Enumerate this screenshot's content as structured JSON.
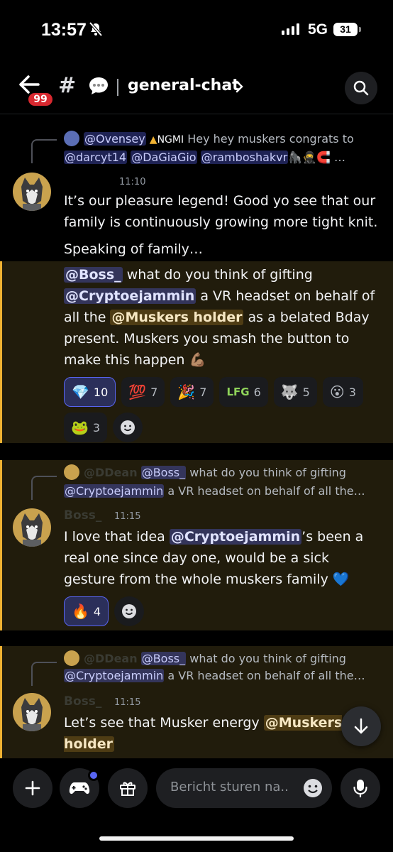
{
  "status": {
    "time": "13:57",
    "network": "5G",
    "battery": "31"
  },
  "header": {
    "unread_badge": "99",
    "hash": "#",
    "channel": "general-chat"
  },
  "messages": {
    "m1": {
      "reply_author": "@Ovensey",
      "reply_tag": "NGMI",
      "reply_text": " Hey hey muskers congrats to",
      "reply_mentions": [
        "@darcyt14",
        "@DaGiaGio",
        "@ramboshakvr"
      ],
      "reply_tail": "🦍🥷🧲 …",
      "time": "11:10",
      "text1": "It’s our pleasure legend! Good yo see that our family is continuously growing more tight knit.",
      "text2": "Speaking of family…",
      "hl_mention1": "@Boss_",
      "hl_t1": " what do you think of gifting",
      "hl_mention2": "@Cryptoejammin",
      "hl_t2": " a VR headset on behalf of all the ",
      "hl_mention3": "@Muskers holder",
      "hl_t3": " as a belated Bday present. Muskers you smash the button to make this happen 💪🏽",
      "reactions": [
        {
          "emoji": "💎",
          "count": "10"
        },
        {
          "emoji": "💯",
          "count": "7"
        },
        {
          "emoji": "🎉",
          "count": "7"
        },
        {
          "emoji": "LFG",
          "count": "6"
        },
        {
          "emoji": "🐺",
          "count": "5"
        },
        {
          "emoji": "😮",
          "count": "3"
        },
        {
          "emoji": "🐸",
          "count": "3"
        }
      ]
    },
    "m2": {
      "reply_author": "@DDean",
      "reply_mention": "@Boss_",
      "reply_text": " what do you think of gifting",
      "reply_mention2": "@Cryptoejammin",
      "reply_text2": " a VR headset on behalf of all the…",
      "author": "Boss_",
      "time": "11:15",
      "t1": "I love that idea  ",
      "mention": "@Cryptoejammin",
      "t2": "’s been a real one since day one,  would be a sick gesture from the whole muskers family 💙",
      "reactions": [
        {
          "emoji": "🔥",
          "count": "4"
        }
      ]
    },
    "m3": {
      "reply_author": "@DDean",
      "reply_mention": "@Boss_",
      "reply_text": " what do you think of gifting",
      "reply_mention2": "@Cryptoejammin",
      "reply_text2": " a VR headset on behalf of all the…",
      "author": "Boss_",
      "time": "11:15",
      "t1": "Let’s see that Musker energy ",
      "mention": "@Muskers holder"
    }
  },
  "composer": {
    "placeholder": "Bericht sturen na.."
  },
  "colors": {
    "accent": "#5865f2",
    "highlight_bar": "#f0b232",
    "badge": "#d7282f"
  },
  "icons": [
    "bell-slash-icon",
    "back-arrow-icon",
    "chat-bubble-icon",
    "chevron-right-icon",
    "search-icon",
    "add-reaction-icon",
    "arrow-down-icon",
    "plus-icon",
    "gamepad-icon",
    "gift-icon",
    "smiley-icon",
    "microphone-icon"
  ]
}
